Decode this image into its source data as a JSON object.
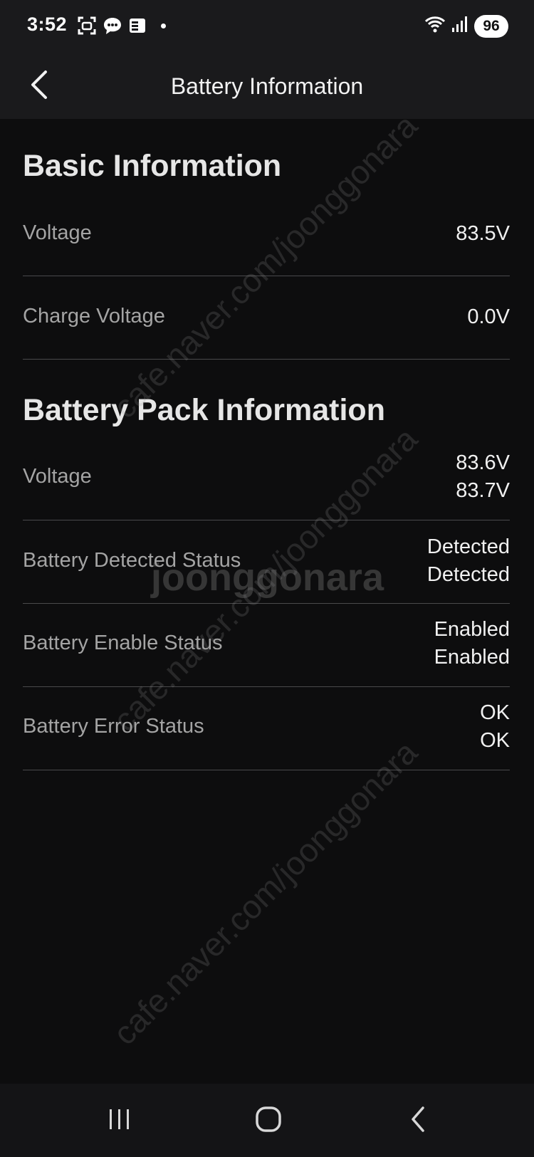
{
  "status_bar": {
    "time": "3:52",
    "left_icons": [
      "screenshot-icon",
      "chat-bubble-icon",
      "news-icon"
    ],
    "right_icons": [
      "wifi-icon",
      "signal-bars-icon"
    ],
    "battery_level": "96"
  },
  "app_bar": {
    "title": "Battery Information",
    "back_icon": "chevron-left-icon"
  },
  "basic_info": {
    "heading": "Basic Information",
    "rows": [
      {
        "label": "Voltage",
        "values": [
          "83.5V"
        ]
      },
      {
        "label": "Charge Voltage",
        "values": [
          "0.0V"
        ]
      }
    ]
  },
  "pack_info": {
    "heading": "Battery Pack Information",
    "rows": [
      {
        "label": "Voltage",
        "values": [
          "83.6V",
          "83.7V"
        ]
      },
      {
        "label": "Battery Detected Status",
        "values": [
          "Detected",
          "Detected"
        ]
      },
      {
        "label": "Battery Enable Status",
        "values": [
          "Enabled",
          "Enabled"
        ]
      },
      {
        "label": "Battery Error Status",
        "values": [
          "OK",
          "OK"
        ]
      }
    ]
  },
  "nav_bar": {
    "icons": [
      "recent-apps-icon",
      "home-icon",
      "back-icon"
    ]
  },
  "watermark": {
    "text": "cafe.naver.com/joonggonara",
    "logo": "joonggonara"
  },
  "colors": {
    "background": "#0d0d0e",
    "bar_background": "#1a1a1c",
    "label_gray": "#a4a4a4",
    "divider": "#4a4a4c"
  }
}
